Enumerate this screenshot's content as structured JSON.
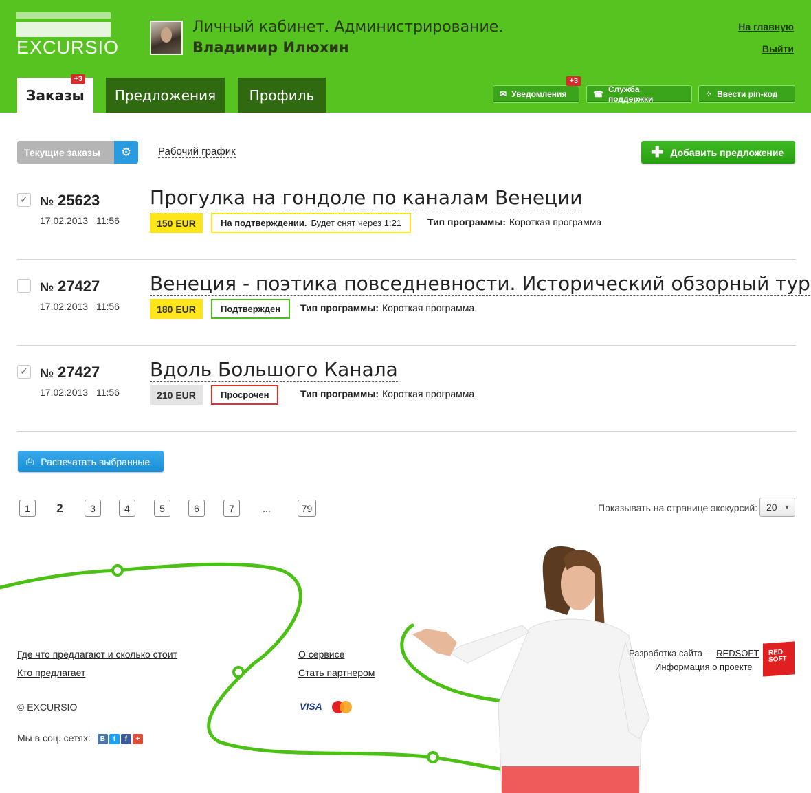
{
  "header": {
    "logo": "EXCURSIO",
    "cabinet_title": "Личный кабинет. Администрирование.",
    "user_name": "Владимир Илюхин",
    "home_link": "На главную",
    "logout_link": "Выйти",
    "tabs": [
      {
        "label": "Заказы",
        "badge": "+3"
      },
      {
        "label": "Предложения"
      },
      {
        "label": "Профиль"
      }
    ],
    "buttons": [
      {
        "label": "Уведомления",
        "badge": "+3",
        "icon": "envelope-icon"
      },
      {
        "label": "Служба поддержки",
        "icon": "headset-icon"
      },
      {
        "label": "Ввести pin-код",
        "icon": "keypad-icon"
      }
    ]
  },
  "toolbar": {
    "current_orders": "Текущие заказы",
    "schedule": "Рабочий график",
    "add_offer": "Добавить предложение"
  },
  "orders": [
    {
      "checked": true,
      "number_sign": "№",
      "number": "25623",
      "date": "17.02.2013",
      "time": "11:56",
      "title": "Прогулка на гондоле по каналам Венеции",
      "price": "150 EUR",
      "price_color": "#ffe61a",
      "status_bold": "На подтверждении.",
      "status_text": "Будет снят через 1:21",
      "status_color": "#ffe61a",
      "program_label": "Тип программы:",
      "program_value": "Короткая программа"
    },
    {
      "checked": false,
      "number_sign": "№",
      "number": "27427",
      "date": "17.02.2013",
      "time": "11:56",
      "title": "Венеция - поэтика повседневности. Исторический обзорный тур",
      "price": "180 EUR",
      "price_color": "#ffe61a",
      "status_bold": "Подтвержден",
      "status_text": "",
      "status_color": "#4fbf20",
      "program_label": "Тип программы:",
      "program_value": "Короткая программа"
    },
    {
      "checked": true,
      "number_sign": "№",
      "number": "27427",
      "date": "17.02.2013",
      "time": "11:56",
      "title": "Вдоль Большого Канала",
      "price": "210 EUR",
      "price_color": "#e3e3e3",
      "status_bold": "Просрочен",
      "status_text": "",
      "status_color": "#e0302c",
      "program_label": "Тип программы:",
      "program_value": "Короткая программа"
    }
  ],
  "print_button": "Распечатать выбранные",
  "pagination": {
    "pages": [
      "1",
      "2",
      "3",
      "4",
      "5",
      "6",
      "7",
      "...",
      "79"
    ],
    "current": "2",
    "per_page_label": "Показывать на странице экскурсий:",
    "per_page_value": "20"
  },
  "footer": {
    "links_left": [
      "Где что предлагают и сколько стоит",
      "Кто предлагает"
    ],
    "links_mid": [
      "О сервисе",
      "Стать партнером"
    ],
    "copyright": "© EXCURSIO",
    "social_label": "Мы в соц. сетях:",
    "social_icons": [
      "vk-icon",
      "twitter-icon",
      "facebook-icon",
      "googleplus-icon"
    ],
    "payments": [
      "VISA",
      "mastercard-icon"
    ],
    "dev_label": "Разработка сайта —",
    "dev_link": "REDSOFT",
    "project_info": "Информация о проекте",
    "redsoft_logo": "RED SOFT"
  },
  "colors": {
    "brand_green": "#57c321",
    "dark_green": "#2f6a11",
    "accent_blue": "#2b9be0"
  }
}
